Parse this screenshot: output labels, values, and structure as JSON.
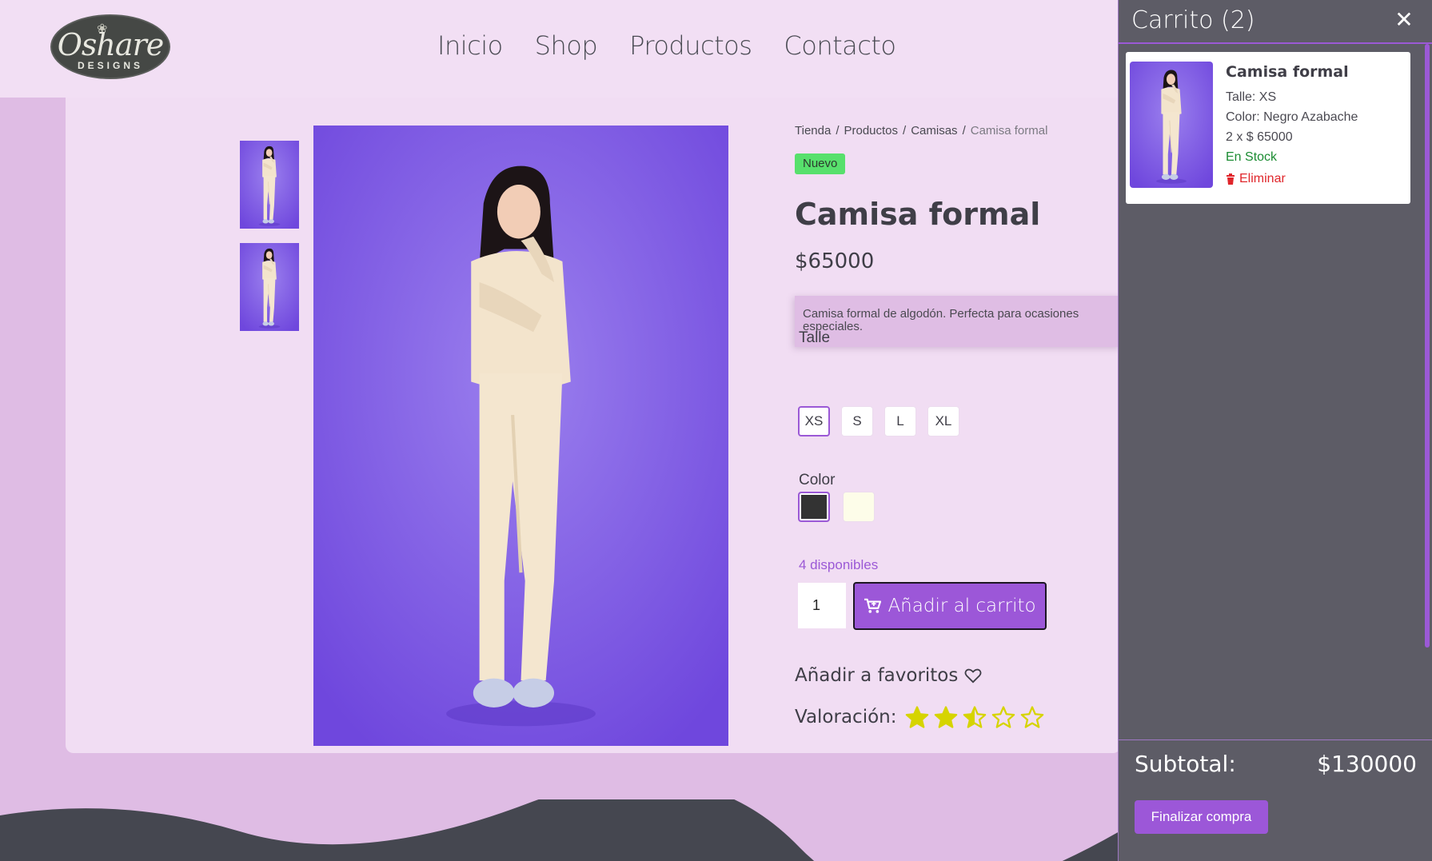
{
  "brand": {
    "logo_main": "Oshare",
    "logo_sub": "DESIGNS"
  },
  "nav": {
    "items": [
      {
        "label": "Inicio"
      },
      {
        "label": "Shop"
      },
      {
        "label": "Productos"
      },
      {
        "label": "Contacto"
      }
    ]
  },
  "breadcrumb": [
    "Tienda",
    "Productos",
    "Camisas",
    "Camisa formal"
  ],
  "product": {
    "badge": "Nuevo",
    "title": "Camisa formal",
    "price": "$65000",
    "description": "Camisa formal de algodón. Perfecta para ocasiones especiales.",
    "size_label": "Talle",
    "sizes": [
      "XS",
      "S",
      "L",
      "XL"
    ],
    "selected_size": "XS",
    "color_label": "Color",
    "colors": [
      {
        "name": "Negro Azabache",
        "hex": "#333333"
      },
      {
        "name": "crema",
        "hex": "#fdfde9"
      }
    ],
    "available": "4 disponibles",
    "quantity": "1",
    "add_to_cart": "Añadir al carrito",
    "favorites": "Añadir a favoritos",
    "rating_label": "Valoración:",
    "rating": 2.5,
    "rating_max": 5
  },
  "cart": {
    "title": "Carrito (2)",
    "item": {
      "name": "Camisa formal",
      "size": "Talle: XS",
      "color": "Color: Negro Azabache",
      "qty_price": "2 x $ 65000",
      "stock": "En Stock",
      "remove": "Eliminar"
    },
    "subtotal_label": "Subtotal:",
    "subtotal_value": "$130000",
    "checkout": "Finalizar compra"
  },
  "colors": {
    "accent": "#9c57d8",
    "stock": "#1b8c32",
    "remove": "#e0262b",
    "star": "#d6d400"
  }
}
